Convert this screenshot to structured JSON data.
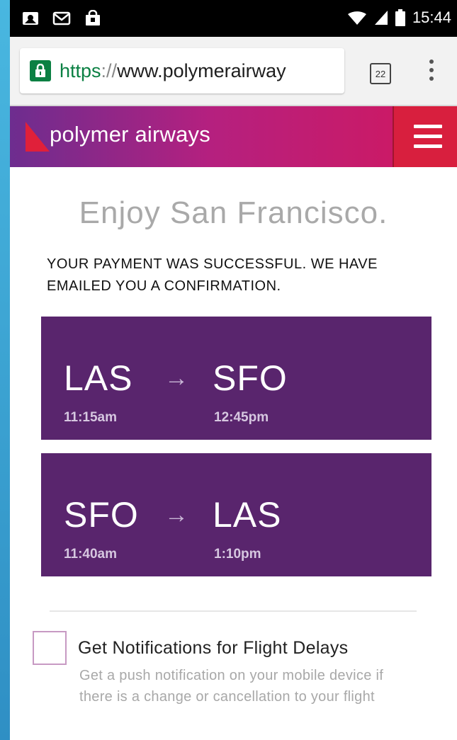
{
  "status_bar": {
    "time": "15:44",
    "left_icons": [
      "notification-icon",
      "mail-icon",
      "shopping-bag-icon"
    ],
    "right_icons": [
      "wifi-icon",
      "signal-icon",
      "battery-icon"
    ]
  },
  "browser": {
    "url_scheme": "https",
    "url_separator": "://",
    "url_host": "www.polymerairway",
    "tab_count": "22",
    "lock_icon": "lock-icon",
    "menu_icon": "more-vert-icon"
  },
  "site_header": {
    "brand": "polymer airways",
    "menu_icon": "hamburger-icon",
    "colors": {
      "gradient_start": "#6d2d8f",
      "gradient_end": "#d2185e",
      "menu_bg": "#d81f3e"
    }
  },
  "main": {
    "headline": "Enjoy San Francisco.",
    "confirmation": "YOUR PAYMENT WAS SUCCESSFUL. WE HAVE EMAILED YOU A CONFIRMATION.",
    "flights": [
      {
        "from": "LAS",
        "to": "SFO",
        "arrow": "→",
        "depart": "11:15am",
        "arrive": "12:45pm"
      },
      {
        "from": "SFO",
        "to": "LAS",
        "arrow": "→",
        "depart": "11:40am",
        "arrive": "1:10pm"
      }
    ],
    "notifications": {
      "title": "Get Notifications for Flight Delays",
      "description": "Get a push notification on your mobile device if there is a change or cancellation to your flight",
      "checked": false
    }
  }
}
